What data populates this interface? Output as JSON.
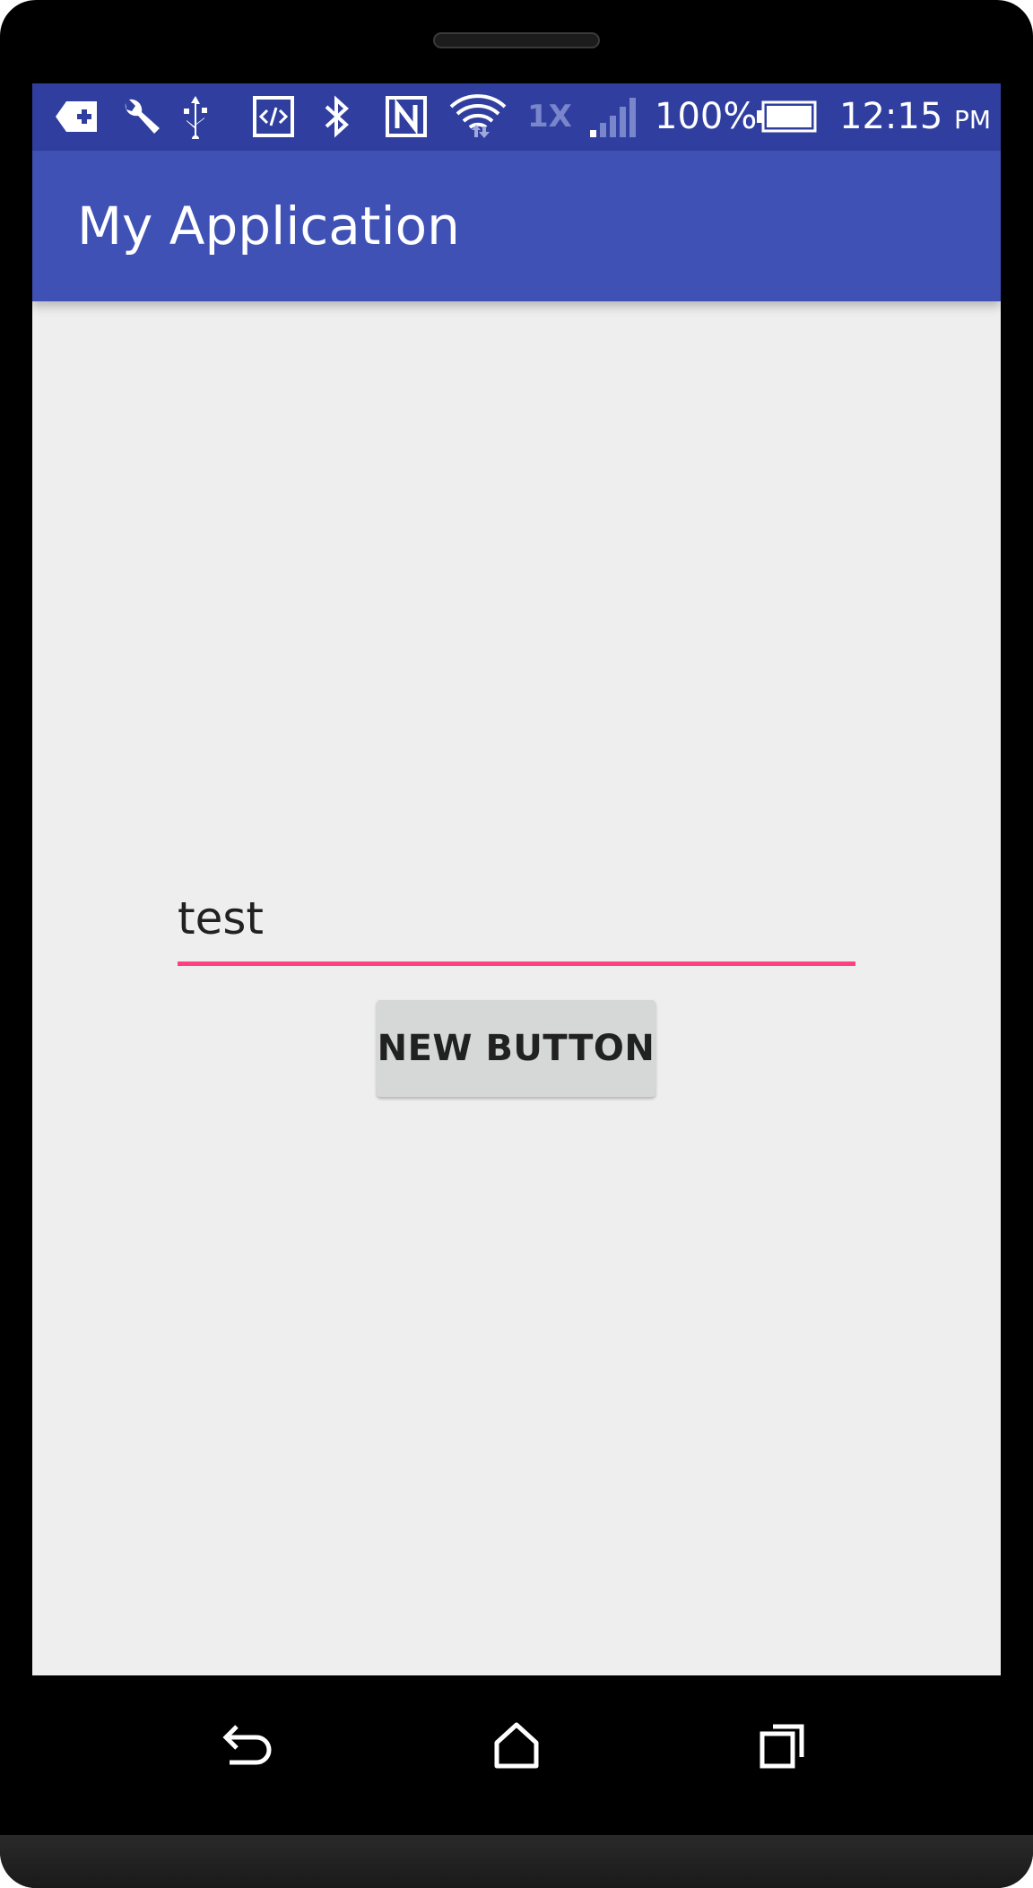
{
  "status_bar": {
    "icons": [
      "add-tag-icon",
      "wrench-icon",
      "usb-icon",
      "code-icon",
      "bluetooth-icon",
      "nfc-icon",
      "wifi-icon"
    ],
    "network_type": "1X",
    "battery_percent": "100%",
    "time": "12:15",
    "am_pm": "PM"
  },
  "app_bar": {
    "title": "My Application"
  },
  "main": {
    "edit_text_value": "test",
    "button_label": "NEW BUTTON"
  },
  "nav_bar": {
    "icons": [
      "back-icon",
      "home-icon",
      "recents-icon"
    ]
  },
  "colors": {
    "status_bar": "#303f9f",
    "app_bar": "#3f51b5",
    "accent": "#ff4081",
    "background": "#eeeeee"
  }
}
